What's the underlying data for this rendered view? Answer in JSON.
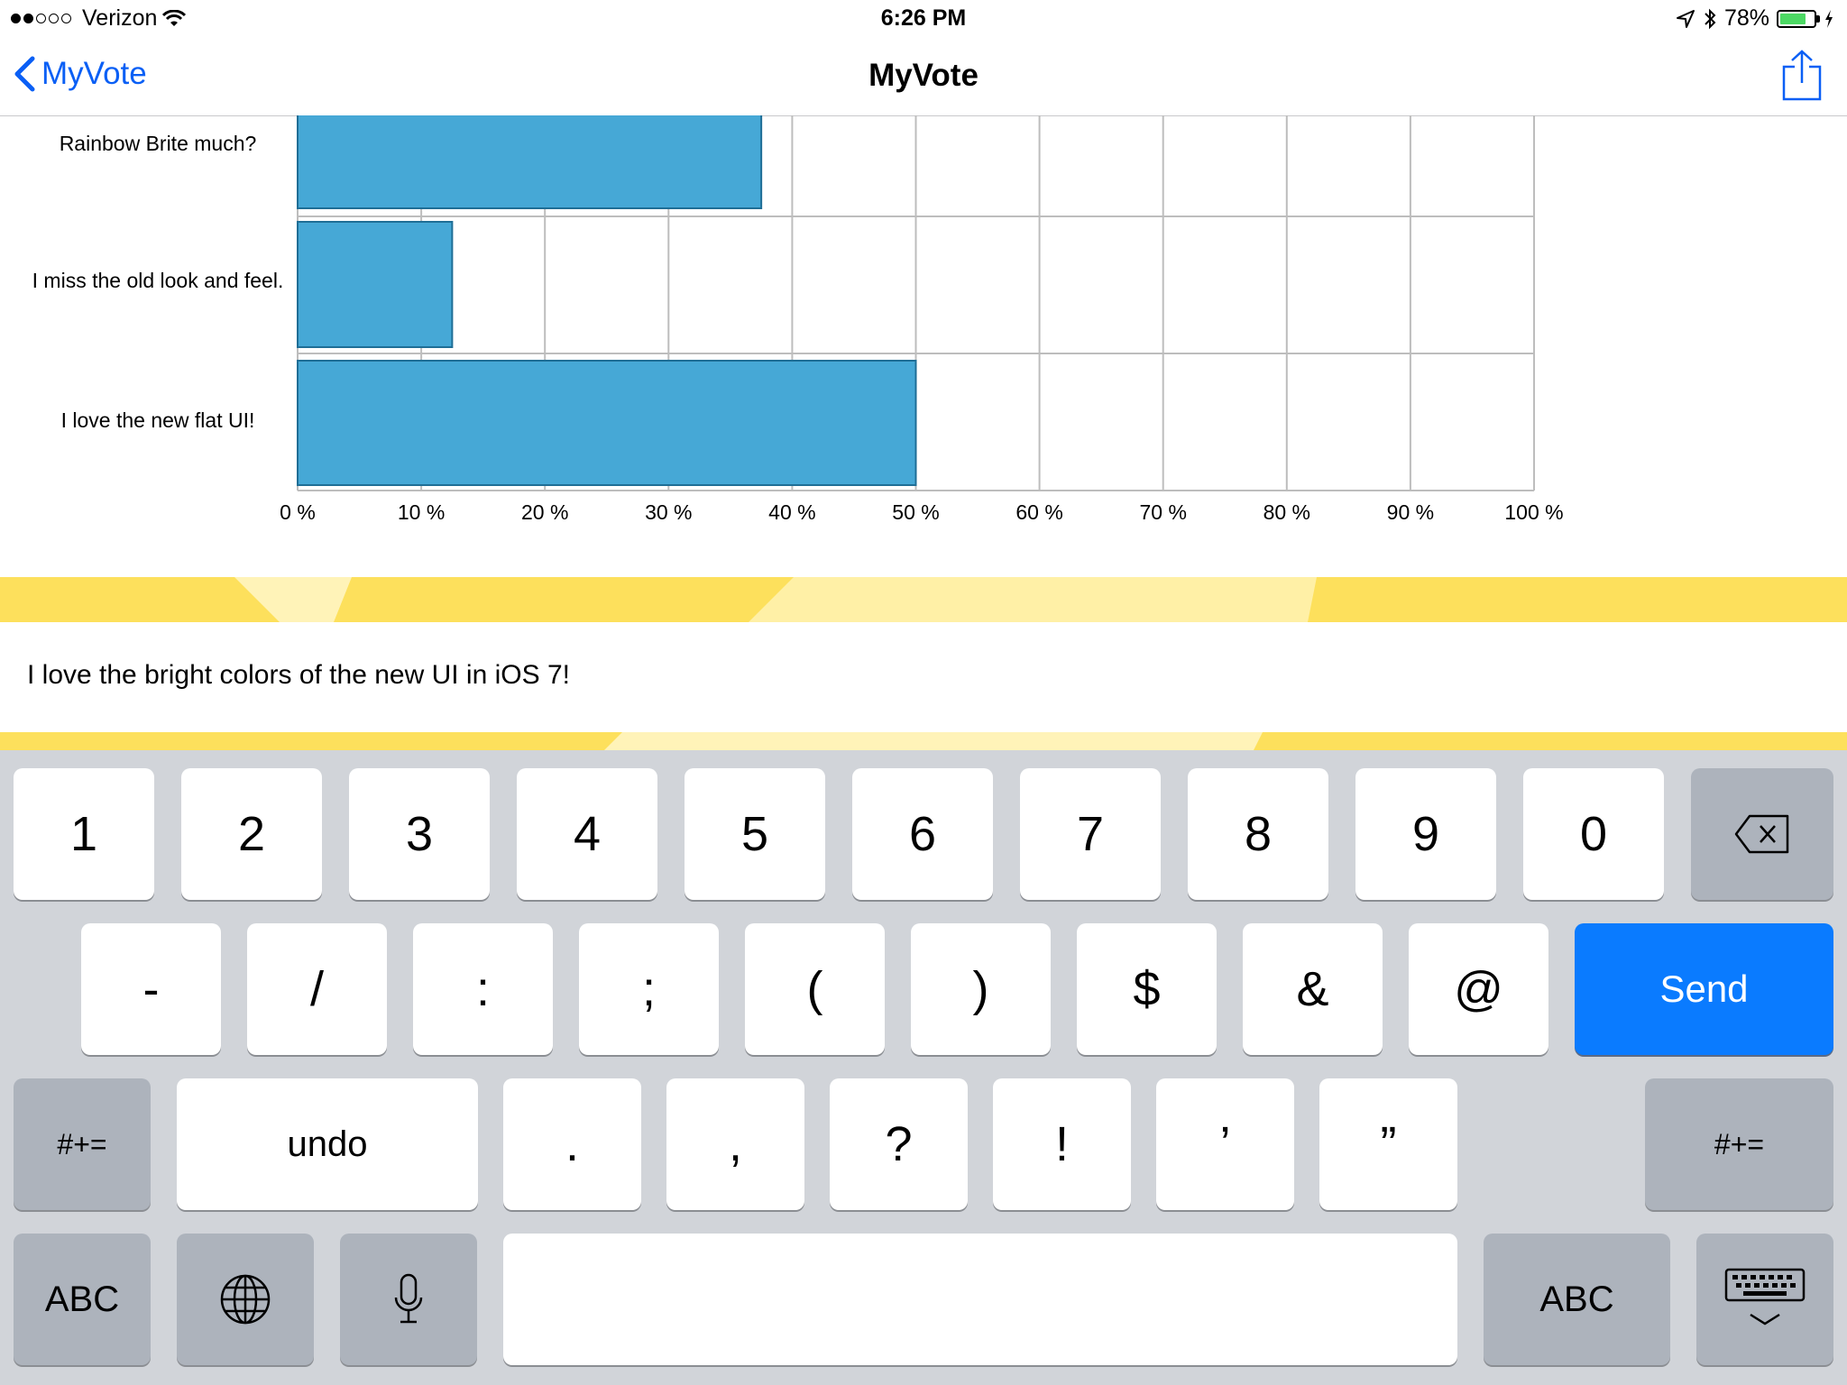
{
  "status_bar": {
    "carrier": "Verizon",
    "time": "6:26 PM",
    "battery": "78%",
    "battery_level": 0.78,
    "signal_bars_filled": 2,
    "signal_bars_total": 5
  },
  "nav": {
    "back_label": "MyVote",
    "title": "MyVote",
    "share_icon": "share-icon",
    "accent_color": "#0a5ff5"
  },
  "chart_data": {
    "type": "bar",
    "orientation": "horizontal",
    "categories": [
      "Rainbow Brite much?",
      "I miss the old look and feel.",
      "I love the new flat UI!"
    ],
    "values": [
      37.5,
      12.5,
      50
    ],
    "xlim": [
      0,
      100
    ],
    "x_ticks": [
      "0 %",
      "10 %",
      "20 %",
      "30 %",
      "40 %",
      "50 %",
      "60 %",
      "70 %",
      "80 %",
      "90 %",
      "100 %"
    ],
    "grid": true,
    "bar_color": "#46a8d6"
  },
  "comment": {
    "text": "I love the bright colors of the new UI in iOS 7!"
  },
  "keyboard": {
    "row1": [
      "1",
      "2",
      "3",
      "4",
      "5",
      "6",
      "7",
      "8",
      "9",
      "0"
    ],
    "delete_icon": "delete-icon",
    "row2": [
      "-",
      "/",
      ":",
      ";",
      "(",
      ")",
      "$",
      "&",
      "@"
    ],
    "send_label": "Send",
    "row3_left": "#+=",
    "undo_label": "undo",
    "row3": [
      ".",
      ",",
      "?",
      "!",
      "’",
      "”"
    ],
    "row3_right": "#+=",
    "abc_left": "ABC",
    "globe_icon": "globe-icon",
    "mic_icon": "microphone-icon",
    "abc_right": "ABC",
    "hide_icon": "keyboard-hide-icon",
    "send_color": "#0a7bff"
  }
}
